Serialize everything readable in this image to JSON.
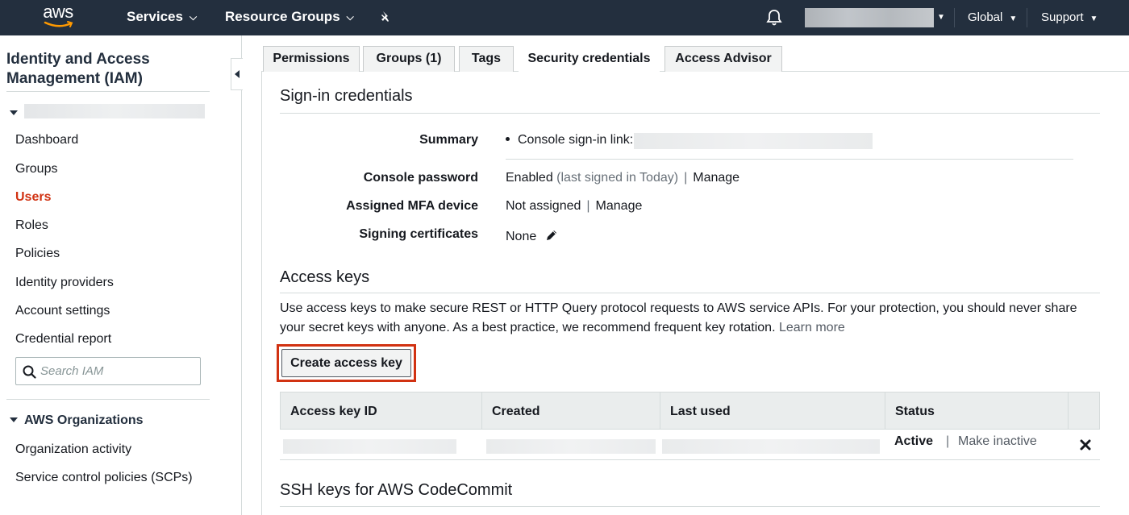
{
  "topnav": {
    "logo": "aws",
    "services": "Services",
    "resource_groups": "Resource Groups",
    "region": "Global",
    "support": "Support"
  },
  "sidebar": {
    "title": "Identity and Access Management (IAM)",
    "items": [
      {
        "label": "Dashboard",
        "active": false
      },
      {
        "label": "Groups",
        "active": false
      },
      {
        "label": "Users",
        "active": true
      },
      {
        "label": "Roles",
        "active": false
      },
      {
        "label": "Policies",
        "active": false
      },
      {
        "label": "Identity providers",
        "active": false
      },
      {
        "label": "Account settings",
        "active": false
      },
      {
        "label": "Credential report",
        "active": false
      }
    ],
    "search_placeholder": "Search IAM",
    "org_section": "AWS Organizations",
    "org_items": [
      "Organization activity",
      "Service control policies (SCPs)"
    ]
  },
  "tabs": [
    {
      "label": "Permissions",
      "active": false
    },
    {
      "label": "Groups (1)",
      "active": false
    },
    {
      "label": "Tags",
      "active": false
    },
    {
      "label": "Security credentials",
      "active": true
    },
    {
      "label": "Access Advisor",
      "active": false
    }
  ],
  "signin": {
    "title": "Sign-in credentials",
    "summary_label": "Summary",
    "summary_value": "Console sign-in link:",
    "console_password_label": "Console password",
    "console_password_value": "Enabled",
    "console_password_note": "(last signed in Today)",
    "manage": "Manage",
    "mfa_label": "Assigned MFA device",
    "mfa_value": "Not assigned",
    "signing_label": "Signing certificates",
    "signing_value": "None"
  },
  "access_keys": {
    "title": "Access keys",
    "description": "Use access keys to make secure REST or HTTP Query protocol requests to AWS service APIs. For your protection, you should never share your secret keys with anyone. As a best practice, we recommend frequent key rotation.",
    "learn_more": "Learn more",
    "create_button": "Create access key",
    "columns": [
      "Access key ID",
      "Created",
      "Last used",
      "Status"
    ],
    "rows": [
      {
        "status": "Active",
        "action": "Make inactive"
      }
    ]
  },
  "ssh": {
    "title": "SSH keys for AWS CodeCommit"
  },
  "colors": {
    "nav_bg": "#232f3e",
    "active_link": "#d13212",
    "highlight": "#d13212"
  }
}
